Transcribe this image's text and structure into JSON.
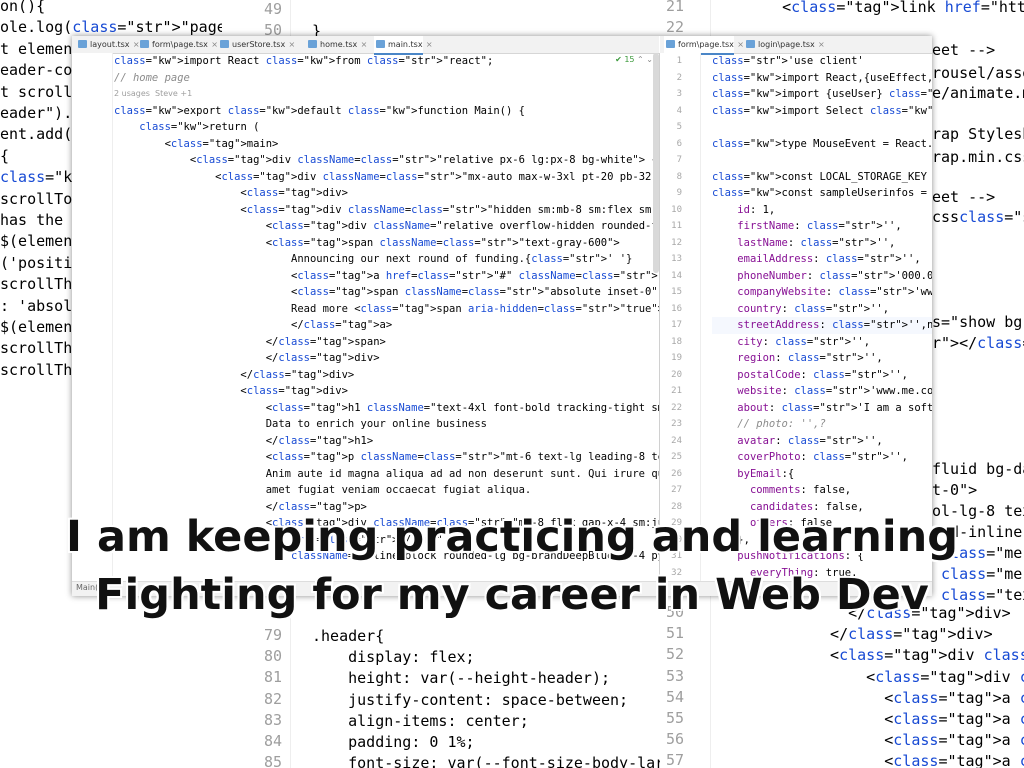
{
  "colors": {
    "keyword": "#0033b3",
    "string": "#067d17",
    "comment": "#8c8c8c",
    "accent": "#4a86c7"
  },
  "background_left": {
    "lines": [
      "on(){",
      "ole.log(\"page loaded\");",
      "t element",
      "eader-con",
      "t scrollT",
      "eader\").c",
      "ent.add(w",
      "{",
      "const p =",
      "scrollTop",
      "has the u",
      "$(element",
      "('positio",
      "scrollThr",
      ": 'absolu",
      "$(element",
      "scrollThr",
      "scrollThr"
    ]
  },
  "background_mid": {
    "top_lines": [
      {
        "num": "49",
        "code": ""
      },
      {
        "num": "50",
        "code": "}"
      }
    ],
    "bottom_lines": [
      {
        "num": "79",
        "code": ".header{"
      },
      {
        "num": "80",
        "code": "    display: flex;"
      },
      {
        "num": "81",
        "code": "    height: var(--height-header);"
      },
      {
        "num": "82",
        "code": "    justify-content: space-between;"
      },
      {
        "num": "83",
        "code": "    align-items: center;"
      },
      {
        "num": "84",
        "code": "    padding: 0 1%;"
      },
      {
        "num": "85",
        "code": "    font-size: var(--font-size-body-lar"
      }
    ]
  },
  "background_right": {
    "top_lines": [
      {
        "num": "21",
        "code": "    <link href=\"https://cdn.jsdelivr."
      },
      {
        "num": "22",
        "code": ""
      }
    ],
    "side_fragments": [
      "eet -->",
      "rousel/asset",
      "e/animate.m",
      "rap Styleshe",
      "rap.min.css",
      "eet -->",
      "css\" rel=\"s",
      "s=\"show bg-",
      "r\"></div>",
      "fluid bg-da",
      "t-0\">",
      "ol-lg-8 text",
      "=\"d-inline-",
      " class=\"me-",
      " class=\"me-",
      " class=\"tex"
    ],
    "bottom_lines": [
      {
        "num": "50",
        "code": "    </div>"
      },
      {
        "num": "51",
        "code": "  </div>"
      },
      {
        "num": "52",
        "code": "  <div class=\"col-lg-4 text"
      },
      {
        "num": "53",
        "code": "      <div class=\"d-inline-"
      },
      {
        "num": "54",
        "code": "        <a class=\"btn btn"
      },
      {
        "num": "55",
        "code": "        <a class=\"btn btn"
      },
      {
        "num": "56",
        "code": "        <a class=\"btn btn"
      },
      {
        "num": "57",
        "code": "        <a class=\"btn btn"
      }
    ]
  },
  "front_editor": {
    "left_tabs": [
      {
        "label": "layout.tsx"
      },
      {
        "label": "form\\page.tsx"
      },
      {
        "label": "userStore.tsx"
      },
      {
        "label": "home.tsx"
      },
      {
        "label": "main.tsx"
      }
    ],
    "right_tabs": [
      {
        "label": "form\\page.tsx"
      },
      {
        "label": "login\\page.tsx"
      }
    ],
    "inspection": {
      "count": "15"
    },
    "left_code": [
      "import React from \"react\";",
      "// home page",
      "2 usages  Steve +1",
      "export default function Main() {",
      "    return (",
      "        <main>",
      "            <div className=\"relative px-6 lg:px-8 bg-white\"> {/* change to the white backgr",
      "                <div className=\"mx-auto max-w-3xl pt-20 pb-32 sm:pt-48 sm:pb-40\">",
      "                    <div>",
      "                    <div className=\"hidden sm:mb-8 sm:flex sm:justify-center\">",
      "                        <div className=\"relative overflow-hidden rounded-full py-1.5 px-4 t",
      "                        <span className=\"text-gray-600\">",
      "                            Announcing our next round of funding.{' '}",
      "                            <a href=\"#\" className=\"font-semibold text-indigo-600\">",
      "                            <span className=\"absolute inset-0\" aria-hidden=\"true\" />",
      "                            Read more <span aria-hidden=\"true\">&rarr;</span>",
      "                            </a>",
      "                        </span>",
      "                        </div>",
      "                    </div>",
      "                    <div>",
      "                        <h1 className=\"text-4xl font-bold tracking-tight sm:text-center sm:",
      "                        Data to enrich your online business",
      "                        </h1>",
      "                        <p className=\"mt-6 text-lg leading-8 text-gray-600 sm:text-center\">",
      "                        Anim aute id magna aliqua ad ad non deserunt sunt. Qui irure qui lo",
      "                        amet fugiat veniam occaecat fugiat aliqua.",
      "                        </p>",
      "                        <div className=\"mt-8 flex gap-x-4 sm:justify-center\">",
      "                            href=\"/form\"",
      "                            className=\"inline-block rounded-lg bg-brandDeepBlue px-4 py-1.5"
    ],
    "right_code": [
      {
        "num": "1",
        "code": "'use client'"
      },
      {
        "num": "2",
        "code": "import React,{useEffect, useState} f"
      },
      {
        "num": "3",
        "code": "import {useUser} from \"../../contex"
      },
      {
        "num": "4",
        "code": "import Select from 'react-select';"
      },
      {
        "num": "5",
        "code": ""
      },
      {
        "num": "6",
        "code": "type MouseEvent = React.MouseEvent<H"
      },
      {
        "num": "7",
        "code": ""
      },
      {
        "num": "8",
        "code": "const LOCAL_STORAGE_KEY = 'weightUse"
      },
      {
        "num": "9",
        "code": "const sampleUserinfos = {"
      },
      {
        "num": "10",
        "code": "    id: 1,"
      },
      {
        "num": "11",
        "code": "    firstName: '',"
      },
      {
        "num": "12",
        "code": "    lastName: '',"
      },
      {
        "num": "13",
        "code": "    emailAddress: '',"
      },
      {
        "num": "14",
        "code": "    phoneNumber: '000.000.0000',"
      },
      {
        "num": "15",
        "code": "    companyWebsite: 'www.example.com',"
      },
      {
        "num": "16",
        "code": "    country: '',"
      },
      {
        "num": "17",
        "code": "    streetAddress: '',ng"
      },
      {
        "num": "18",
        "code": "    city: '',"
      },
      {
        "num": "19",
        "code": "    region: '',"
      },
      {
        "num": "20",
        "code": "    postalCode: '',"
      },
      {
        "num": "21",
        "code": "    website: 'www.me.com',"
      },
      {
        "num": "22",
        "code": "    about: 'I am a software engineer',"
      },
      {
        "num": "23",
        "code": "    // photo: '',?"
      },
      {
        "num": "24",
        "code": "    avatar: '',"
      },
      {
        "num": "25",
        "code": "    coverPhoto: '',"
      },
      {
        "num": "26",
        "code": "    byEmail:{"
      },
      {
        "num": "27",
        "code": "      comments: false,"
      },
      {
        "num": "28",
        "code": "      candidates: false,"
      },
      {
        "num": "29",
        "code": "      offers: false"
      },
      {
        "num": "30",
        "code": "    },"
      },
      {
        "num": "31",
        "code": "    pushNotifications: {"
      },
      {
        "num": "32",
        "code": "      everyThing: true,"
      }
    ],
    "status_left": "Main()"
  },
  "caption": {
    "line1": "I am keeping practicing and learning",
    "line2": "Fighting for my career in Web Dev"
  }
}
